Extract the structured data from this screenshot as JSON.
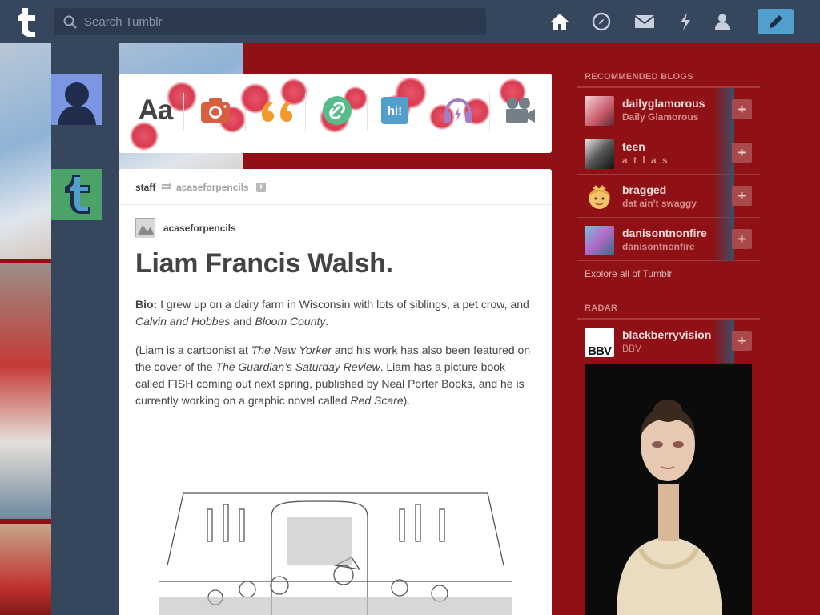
{
  "header": {
    "search_placeholder": "Search Tumblr",
    "nav": [
      "home-icon",
      "explore-icon",
      "messages-icon",
      "activity-icon",
      "account-icon"
    ],
    "compose_icon": "pencil-icon"
  },
  "post_types": [
    {
      "label": "Aa",
      "icon": "text-icon",
      "color": "#444444"
    },
    {
      "label": "",
      "icon": "camera-icon",
      "color": "#d95e40"
    },
    {
      "label": "",
      "icon": "quote-icon",
      "color": "#f2992e"
    },
    {
      "label": "",
      "icon": "link-icon",
      "color": "#56bc8a"
    },
    {
      "label": "hi!",
      "icon": "chat-icon",
      "color": "#529ecc"
    },
    {
      "label": "",
      "icon": "audio-icon",
      "color": "#a77dc2"
    },
    {
      "label": "",
      "icon": "video-icon",
      "color": "#748089"
    }
  ],
  "post": {
    "author": "staff",
    "reblogged_from": "acaseforpencils",
    "original_author": "acaseforpencils",
    "title": "Liam Francis Walsh.",
    "bio_label": "Bio:",
    "bio_text_1": " I grew up on a dairy farm in Wisconsin with lots of siblings, a pet crow, and ",
    "bio_italic_1": "Calvin and Hobbes",
    "bio_text_2": " and ",
    "bio_italic_2": "Bloom County",
    "bio_text_3": ".",
    "p2_a": "(Liam is a cartoonist at ",
    "p2_italic_1": "The New Yorker",
    "p2_b": " and his work has also been featured on the cover of the ",
    "p2_link": "The Guardian’s Saturday Review",
    "p2_c": ". Liam has a picture book called FISH coming out next spring, published by Neal Porter Books, and he is currently working on a graphic novel called ",
    "p2_italic_2": "Red Scare",
    "p2_d": ")."
  },
  "sidebar": {
    "recommended_heading": "RECOMMENDED BLOGS",
    "blogs": [
      {
        "name": "dailyglamorous",
        "subtitle": "Daily Glamorous"
      },
      {
        "name": "teen",
        "subtitle": "a t l a s"
      },
      {
        "name": "bragged",
        "subtitle": "dat ain't swaggy"
      },
      {
        "name": "danisontnonfire",
        "subtitle": "danisontnonfire"
      }
    ],
    "explore_link": "Explore all of Tumblr",
    "radar_heading": "RADAR",
    "radar_blog": {
      "name": "blackberryvision",
      "subtitle": "BBV",
      "avatar_text": "BBV"
    }
  },
  "colors": {
    "header_bg": "#36465d",
    "page_bg": "#8f1115",
    "compose_bg": "#529ecc"
  }
}
